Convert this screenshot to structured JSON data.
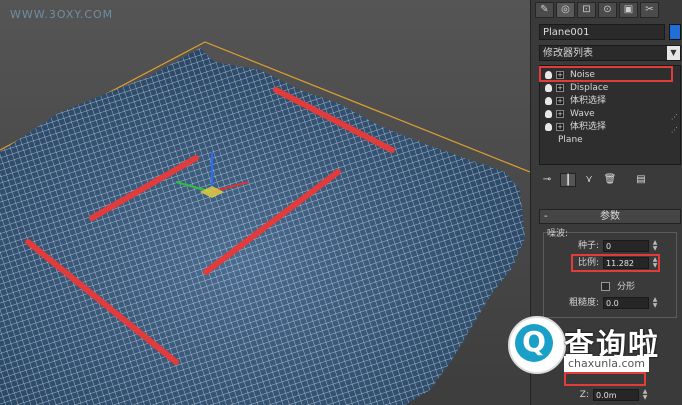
{
  "watermark": "WWW.3OXY.COM",
  "panel": {
    "tabs": [
      "✎",
      "◎",
      "⊡",
      "⊙",
      "▣",
      "✂"
    ],
    "object_name": "Plane001",
    "object_color": "#1f6fd6",
    "modifier_list_label": "修改器列表",
    "stack": [
      {
        "label": "Noise",
        "highlight": true
      },
      {
        "label": "Displace",
        "highlight": false
      },
      {
        "label": "体积选择",
        "highlight": false
      },
      {
        "label": "Wave",
        "highlight": false
      },
      {
        "label": "体积选择",
        "highlight": false
      },
      {
        "label": "Plane",
        "highlight": false
      }
    ],
    "toolbar_icons": [
      "pin-icon",
      "show-end-result-icon",
      "make-unique-icon",
      "remove-modifier-icon",
      "configure-icon"
    ],
    "rollout_title": "参数",
    "rollout_toggle": "-",
    "noise_group_label": "噪波:",
    "seed_label": "种子:",
    "seed_value": "0",
    "scale_label": "比例:",
    "scale_value": "11.282",
    "fractal_label": "分形",
    "roughness_label": "粗糙度:",
    "roughness_value": "0.0",
    "z_label": "Z:",
    "z_value": "0.0m"
  },
  "badge": {
    "glyph": "Q",
    "title": "查询啦",
    "domain": "chaxunla.com"
  },
  "colors": {
    "highlight": "#e23b3b",
    "mesh": "#e9f0f6",
    "surface": "#33506e",
    "accent": "#1aa0c8"
  }
}
